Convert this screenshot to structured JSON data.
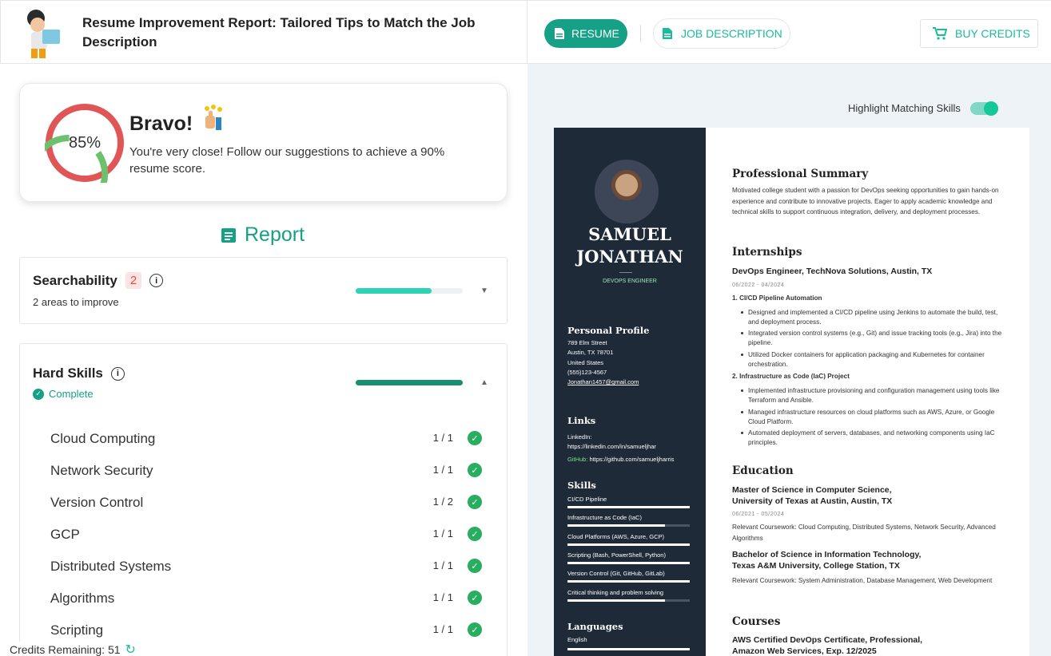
{
  "header": {
    "title": "Resume Improvement Report: Tailored Tips to Match the Job Description"
  },
  "tabs": {
    "resume": "RESUME",
    "job_description": "JOB DESCRIPTION",
    "buy_credits": "BUY CREDITS"
  },
  "score": {
    "percent_label": "85%",
    "value": 0.85,
    "headline": "Bravo!",
    "message": "You're very close! Follow our suggestions to achieve a 90% resume score."
  },
  "report": {
    "title": "Report"
  },
  "searchability": {
    "title": "Searchability",
    "badge": "2",
    "subtitle": "2 areas to improve",
    "progress": 0.71,
    "color": "#2dd4b4"
  },
  "hard_skills": {
    "title": "Hard Skills",
    "status": "Complete",
    "progress": 1.0,
    "color": "#1a8f72",
    "items": [
      {
        "name": "Cloud Computing",
        "count": "1 / 1"
      },
      {
        "name": "Network Security",
        "count": "1 / 1"
      },
      {
        "name": "Version Control",
        "count": "1 / 2"
      },
      {
        "name": "GCP",
        "count": "1 / 1"
      },
      {
        "name": "Distributed Systems",
        "count": "1 / 1"
      },
      {
        "name": "Algorithms",
        "count": "1 / 1"
      },
      {
        "name": "Scripting",
        "count": "1 / 1"
      }
    ]
  },
  "credits": {
    "label": "Credits Remaining: 51"
  },
  "highlight": {
    "label": "Highlight Matching Skills",
    "on": true
  },
  "resume": {
    "first_name": "SAMUEL",
    "last_name": "JONATHAN",
    "role": "DEVOPS ENGINEER",
    "personal_profile": {
      "title": "Personal Profile",
      "lines": [
        "789 Elm Street",
        "Austin, TX 78701",
        "United States",
        "(555)123-4567",
        "Jonathan1457@gmail.com"
      ]
    },
    "links": {
      "title": "Links",
      "linkedin_label": "LinkedIn:",
      "linkedin": "https://linkedin.com/in/samueljhar",
      "github_label": "GitHub:",
      "github": "https://github.com/samueljharris"
    },
    "skills": {
      "title": "Skills",
      "items": [
        {
          "name": "CI/CD Pipeline",
          "level": 1.0
        },
        {
          "name": "Infrastructure as Code (IaC)",
          "level": 0.8
        },
        {
          "name": "Cloud Platforms (AWS, Azure, GCP)",
          "level": 1.0
        },
        {
          "name": "Scripting (Bash, PowerShell, Python)",
          "level": 1.0
        },
        {
          "name": "Version Control (Git, GitHub, GitLab)",
          "level": 1.0
        },
        {
          "name": "Critical thinking and problem solving",
          "level": 0.8
        }
      ]
    },
    "languages": {
      "title": "Languages",
      "items": [
        "English"
      ]
    },
    "summary": {
      "title": "Professional Summary",
      "text": "Motivated college student with a passion for DevOps seeking opportunities to gain hands-on experience and contribute to innovative projects. Eager to apply academic knowledge and technical skills to support continuous integration, delivery, and deployment processes."
    },
    "internships": {
      "title": "Internships",
      "position": "DevOps Engineer, TechNova Solutions, Austin, TX",
      "dates": "06/2022 - 04/2024",
      "project1": "1. CI/CD Pipeline Automation",
      "p1_bullets": [
        "Designed and implemented a CI/CD pipeline using Jenkins to automate the build, test, and deployment process.",
        "Integrated version control systems (e.g., Git) and issue tracking tools (e.g., Jira) into the pipeline.",
        "Utilized Docker containers for application packaging and Kubernetes for container orchestration."
      ],
      "project2": "2. Infrastructure as Code (IaC) Project",
      "p2_bullets": [
        "Implemented infrastructure provisioning and configuration management using tools like Terraform and Ansible.",
        "Managed infrastructure resources on cloud platforms such as AWS, Azure, or Google Cloud Platform.",
        "Automated deployment of servers, databases, and networking components using IaC principles."
      ]
    },
    "education": {
      "title": "Education",
      "degree1": "Master of Science in Computer Science, University of Texas at Austin, Austin, TX",
      "dates1": "06/2021 - 05/2024",
      "course1": "Relevant Coursework: Cloud Computing, Distributed Systems, Network Security, Advanced Algorithms",
      "degree2": "Bachelor of Science in Information Technology, Texas A&M University, College Station, TX",
      "course2": "Relevant Coursework: System Administration, Database Management, Web Development"
    },
    "courses": {
      "title": "Courses",
      "item": "AWS Certified DevOps Certificate, Professional, Amazon Web Services, Exp. 12/2025"
    }
  }
}
